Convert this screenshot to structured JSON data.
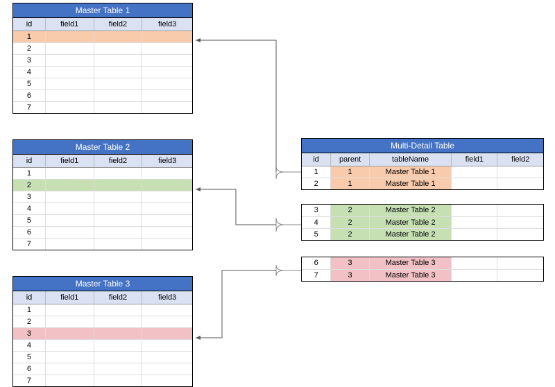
{
  "master1": {
    "title": "Master Table 1",
    "headers": [
      "id",
      "field1",
      "field2",
      "field3"
    ],
    "rows": [
      "1",
      "2",
      "3",
      "4",
      "5",
      "6",
      "7"
    ],
    "highlight_index": 0,
    "highlight_class": "hl-orange"
  },
  "master2": {
    "title": "Master Table 2",
    "headers": [
      "id",
      "field1",
      "field2",
      "field3"
    ],
    "rows": [
      "1",
      "2",
      "3",
      "4",
      "5",
      "6",
      "7"
    ],
    "highlight_index": 1,
    "highlight_class": "hl-green"
  },
  "master3": {
    "title": "Master Table 3",
    "headers": [
      "id",
      "field1",
      "field2",
      "field3"
    ],
    "rows": [
      "1",
      "2",
      "3",
      "4",
      "5",
      "6",
      "7"
    ],
    "highlight_index": 2,
    "highlight_class": "hl-red"
  },
  "detail": {
    "title": "Multi-Detail Table",
    "headers": [
      "id",
      "parent",
      "tableName",
      "field1",
      "field2"
    ],
    "groups": [
      {
        "cell_class": "cell-orange",
        "rows": [
          {
            "id": "1",
            "parent": "1",
            "tableName": "Master Table 1"
          },
          {
            "id": "2",
            "parent": "1",
            "tableName": "Master Table 1"
          }
        ]
      },
      {
        "cell_class": "cell-green",
        "rows": [
          {
            "id": "3",
            "parent": "2",
            "tableName": "Master Table 2"
          },
          {
            "id": "4",
            "parent": "2",
            "tableName": "Master Table 2"
          },
          {
            "id": "5",
            "parent": "2",
            "tableName": "Master Table 2"
          }
        ]
      },
      {
        "cell_class": "cell-red",
        "rows": [
          {
            "id": "6",
            "parent": "3",
            "tableName": "Master Table 3"
          },
          {
            "id": "7",
            "parent": "3",
            "tableName": "Master Table 3"
          }
        ]
      }
    ]
  }
}
